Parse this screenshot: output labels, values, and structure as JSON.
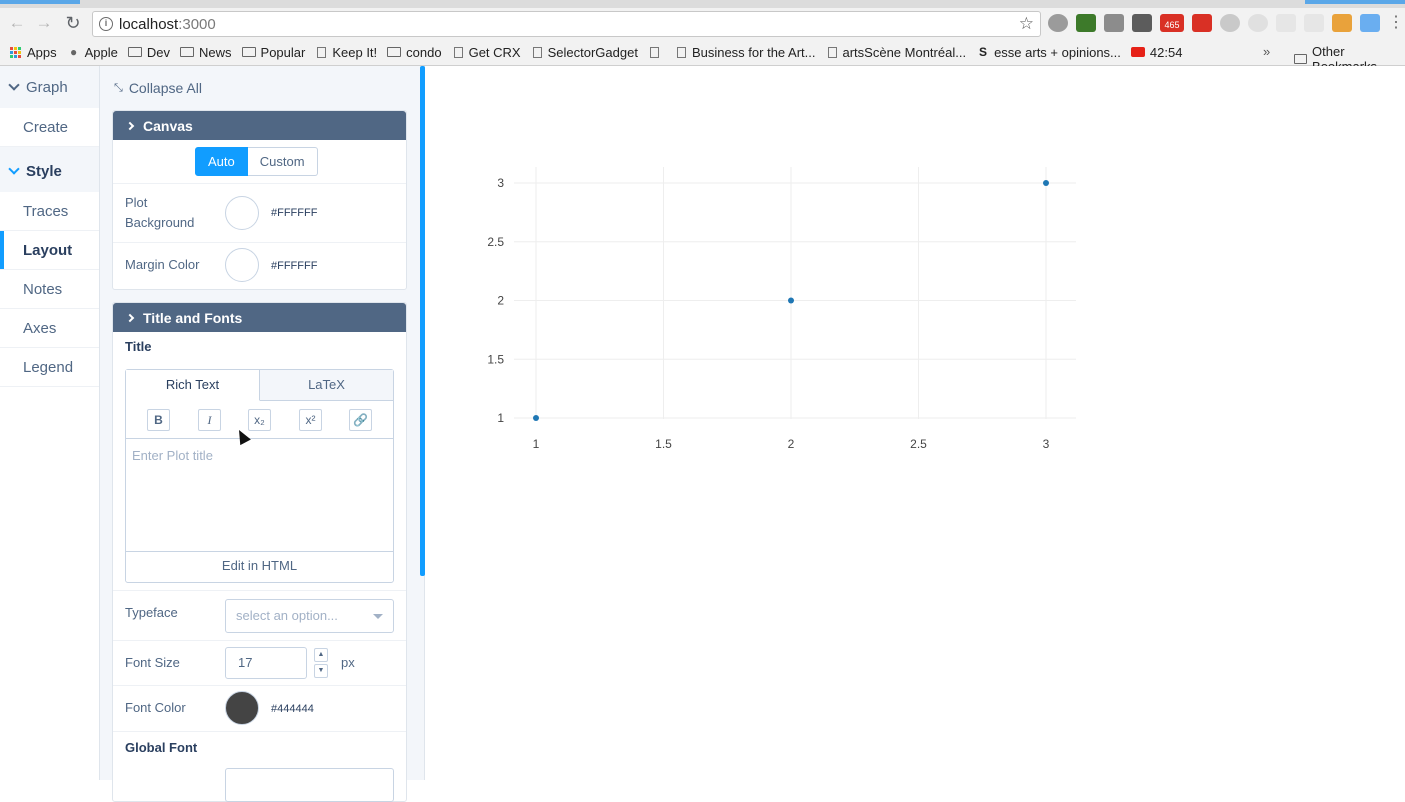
{
  "browser": {
    "url_host": "localhost",
    "url_port": ":3000",
    "bookmarks": [
      {
        "label": "Apps",
        "icon": "apps-icon"
      },
      {
        "label": "Apple",
        "icon": "apple-icon"
      },
      {
        "label": "Dev",
        "icon": "folder-icon"
      },
      {
        "label": "News",
        "icon": "folder-icon"
      },
      {
        "label": "Popular",
        "icon": "folder-icon"
      },
      {
        "label": "Keep It!",
        "icon": "page-icon"
      },
      {
        "label": "condo",
        "icon": "folder-icon"
      },
      {
        "label": "Get CRX",
        "icon": "page-icon"
      },
      {
        "label": "SelectorGadget",
        "icon": "page-icon"
      },
      {
        "label": "",
        "icon": "page-icon"
      },
      {
        "label": "Business for the Art...",
        "icon": "page-icon"
      },
      {
        "label": "artsScène Montréal...",
        "icon": "page-icon"
      },
      {
        "label": "esse arts + opinions...",
        "icon": "s-icon"
      },
      {
        "label": "42:54",
        "icon": "youtube-icon"
      }
    ],
    "more": "»",
    "other_bookmarks": "Other Bookmarks",
    "badge": "465"
  },
  "sidebar": {
    "groups": [
      {
        "label": "Graph",
        "items": [
          "Create"
        ]
      },
      {
        "label": "Style",
        "items": [
          "Traces",
          "Layout",
          "Notes",
          "Axes",
          "Legend"
        ]
      }
    ],
    "active_item": "Layout"
  },
  "panel": {
    "collapse_all": "Collapse All",
    "canvas": {
      "title": "Canvas",
      "mode_auto": "Auto",
      "mode_custom": "Custom",
      "plot_bg_label": "Plot Background",
      "plot_bg_color": "#FFFFFF",
      "margin_label": "Margin Color",
      "margin_color": "#FFFFFF"
    },
    "title_fonts": {
      "title": "Title and Fonts",
      "title_label": "Title",
      "tab_rich": "Rich Text",
      "tab_latex": "LaTeX",
      "tools": [
        "B",
        "I",
        "x₂",
        "x²",
        "link-icon"
      ],
      "placeholder": "Enter Plot title",
      "edit_html": "Edit in HTML",
      "typeface_label": "Typeface",
      "typeface_placeholder": "select an option...",
      "font_size_label": "Font Size",
      "font_size_value": "17",
      "font_size_unit": "px",
      "font_color_label": "Font Color",
      "font_color": "#444444",
      "global_font_label": "Global Font"
    }
  },
  "chart_data": {
    "type": "scatter",
    "x": [
      1,
      2,
      3
    ],
    "y": [
      1,
      2,
      3
    ],
    "xlim": [
      1,
      3
    ],
    "ylim": [
      1,
      3
    ],
    "xticks": [
      "1",
      "1.5",
      "2",
      "2.5",
      "3"
    ],
    "yticks": [
      "1",
      "1.5",
      "2",
      "2.5",
      "3"
    ],
    "marker_color": "#1f77b4",
    "grid": true,
    "title": "",
    "xlabel": "",
    "ylabel": ""
  }
}
